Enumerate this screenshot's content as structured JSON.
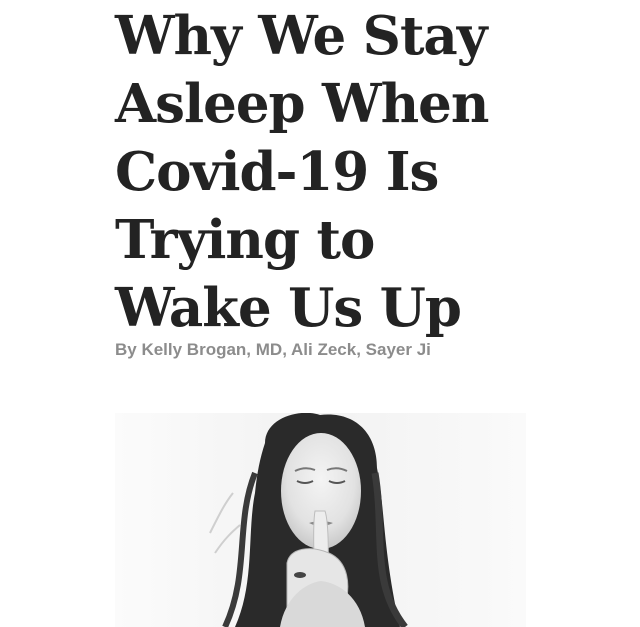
{
  "article": {
    "title_lines": [
      "Why We Stay",
      "Asleep When",
      "Covid-19 Is",
      "Trying to",
      "Wake Us Up"
    ],
    "byline": "By Kelly Brogan, MD, Ali Zeck, Sayer Ji"
  },
  "hero_image": {
    "subject": "woman-shushing-photo",
    "tone": "black-and-white"
  },
  "colors": {
    "headline": "#232323",
    "byline": "#8c8c8c",
    "background": "#ffffff"
  }
}
